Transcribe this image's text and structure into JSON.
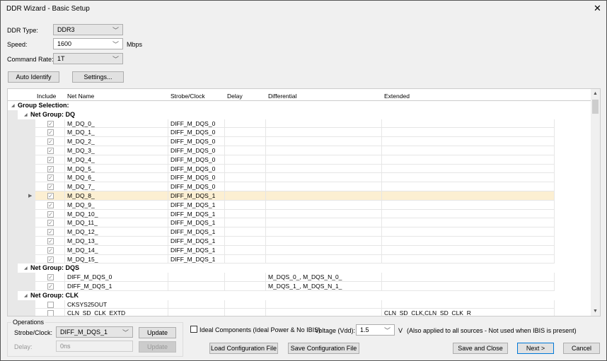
{
  "window": {
    "title": "DDR Wizard - Basic Setup",
    "close": "✕"
  },
  "settings": {
    "ddr_type_label": "DDR Type:",
    "ddr_type": "DDR3",
    "speed_label": "Speed:",
    "speed": "1600",
    "speed_unit": "Mbps",
    "command_rate_label": "Command Rate:",
    "command_rate": "1T",
    "auto_identify": "Auto Identify",
    "settings_btn": "Settings..."
  },
  "grid": {
    "columns": [
      "Include",
      "Net Name",
      "Strobe/Clock",
      "Delay",
      "Differential",
      "Extended"
    ],
    "rows": [
      {
        "type": "root",
        "label": "Group Selection:"
      },
      {
        "type": "group",
        "label": "Net Group: DQ"
      },
      {
        "checked": true,
        "net": "M_DQ_0_",
        "strobe": "DIFF_M_DQS_0",
        "delay": "",
        "diff": "",
        "ext": ""
      },
      {
        "checked": true,
        "net": "M_DQ_1_",
        "strobe": "DIFF_M_DQS_0",
        "delay": "",
        "diff": "",
        "ext": ""
      },
      {
        "checked": true,
        "net": "M_DQ_2_",
        "strobe": "DIFF_M_DQS_0",
        "delay": "",
        "diff": "",
        "ext": ""
      },
      {
        "checked": true,
        "net": "M_DQ_3_",
        "strobe": "DIFF_M_DQS_0",
        "delay": "",
        "diff": "",
        "ext": ""
      },
      {
        "checked": true,
        "net": "M_DQ_4_",
        "strobe": "DIFF_M_DQS_0",
        "delay": "",
        "diff": "",
        "ext": ""
      },
      {
        "checked": true,
        "net": "M_DQ_5_",
        "strobe": "DIFF_M_DQS_0",
        "delay": "",
        "diff": "",
        "ext": ""
      },
      {
        "checked": true,
        "net": "M_DQ_6_",
        "strobe": "DIFF_M_DQS_0",
        "delay": "",
        "diff": "",
        "ext": ""
      },
      {
        "checked": true,
        "net": "M_DQ_7_",
        "strobe": "DIFF_M_DQS_0",
        "delay": "",
        "diff": "",
        "ext": ""
      },
      {
        "checked": true,
        "net": "M_DQ_8_",
        "strobe": "DIFF_M_DQS_1",
        "delay": "",
        "diff": "",
        "ext": "",
        "selected": true
      },
      {
        "checked": true,
        "net": "M_DQ_9_",
        "strobe": "DIFF_M_DQS_1",
        "delay": "",
        "diff": "",
        "ext": ""
      },
      {
        "checked": true,
        "net": "M_DQ_10_",
        "strobe": "DIFF_M_DQS_1",
        "delay": "",
        "diff": "",
        "ext": ""
      },
      {
        "checked": true,
        "net": "M_DQ_11_",
        "strobe": "DIFF_M_DQS_1",
        "delay": "",
        "diff": "",
        "ext": ""
      },
      {
        "checked": true,
        "net": "M_DQ_12_",
        "strobe": "DIFF_M_DQS_1",
        "delay": "",
        "diff": "",
        "ext": ""
      },
      {
        "checked": true,
        "net": "M_DQ_13_",
        "strobe": "DIFF_M_DQS_1",
        "delay": "",
        "diff": "",
        "ext": ""
      },
      {
        "checked": true,
        "net": "M_DQ_14_",
        "strobe": "DIFF_M_DQS_1",
        "delay": "",
        "diff": "",
        "ext": ""
      },
      {
        "checked": true,
        "net": "M_DQ_15_",
        "strobe": "DIFF_M_DQS_1",
        "delay": "",
        "diff": "",
        "ext": ""
      },
      {
        "type": "group",
        "label": "Net Group: DQS"
      },
      {
        "checked": true,
        "net": "DIFF_M_DQS_0",
        "strobe": "",
        "delay": "",
        "diff": "M_DQS_0_, M_DQS_N_0_",
        "ext": ""
      },
      {
        "checked": true,
        "net": "DIFF_M_DQS_1",
        "strobe": "",
        "delay": "",
        "diff": "M_DQS_1_, M_DQS_N_1_",
        "ext": ""
      },
      {
        "type": "group",
        "label": "Net Group: CLK"
      },
      {
        "checked": false,
        "net": "CKSYS25OUT",
        "strobe": "",
        "delay": "",
        "diff": "",
        "ext": ""
      },
      {
        "checked": false,
        "net": "CLN_SD_CLK_EXTD",
        "strobe": "",
        "delay": "",
        "diff": "",
        "ext": "CLN_SD_CLK,CLN_SD_CLK_R"
      }
    ]
  },
  "operations": {
    "title": "Operations",
    "strobe_label": "Strobe/Clock:",
    "strobe": "DIFF_M_DQS_1",
    "update": "Update",
    "delay_label": "Delay:",
    "delay": "0ns",
    "update2": "Update"
  },
  "options": {
    "ideal": "Ideal Components (Ideal Power & No IBIS)",
    "ideal_checked": false,
    "voltage_label": "Voltage (Vdd):",
    "voltage": "1.5",
    "voltage_unit": "V",
    "voltage_note": "(Also applied to all sources - Not used when IBIS is present)"
  },
  "footer": {
    "load": "Load Configuration File",
    "save": "Save Configuration File",
    "save_close": "Save and Close",
    "next": "Next >",
    "cancel": "Cancel"
  }
}
